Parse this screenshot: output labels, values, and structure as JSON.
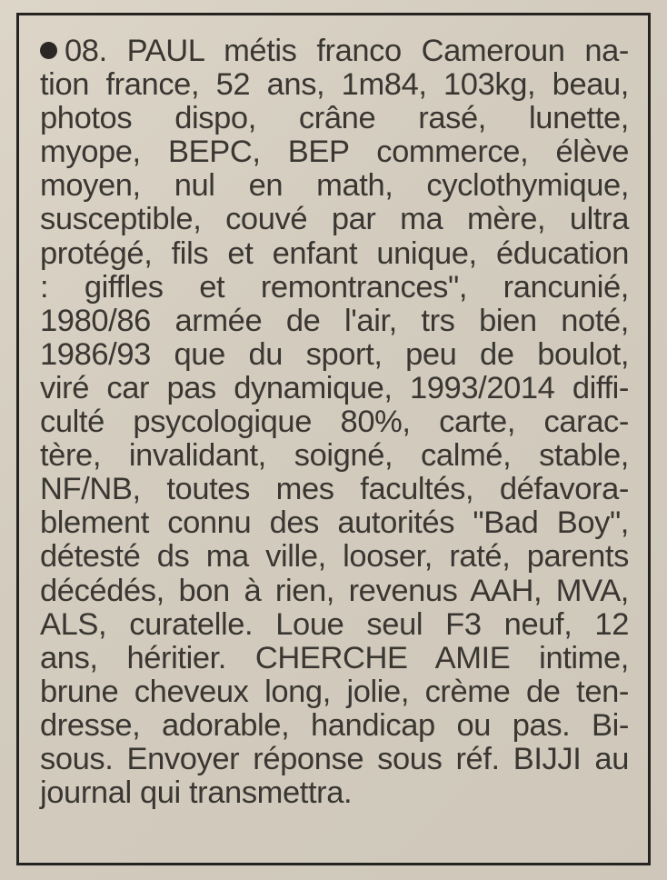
{
  "ad": {
    "lines": [
      "08. PAUL métis franco Cameroun na-",
      "tion france, 52 ans, 1m84, 103kg, beau,",
      "photos dispo, crâne rasé, lunette,",
      "myope, BEPC, BEP commerce, élève",
      "moyen, nul en math, cyclothymique,",
      "susceptible, couvé par ma mère, ultra",
      "protégé, fils et enfant unique, éducation",
      ": giffles et remontrances\", rancunié,",
      "1980/86 armée de l'air, trs bien noté,",
      "1986/93 que du sport, peu de boulot,",
      "viré car pas dynamique, 1993/2014 diffi-",
      "culté psycologique 80%, carte, carac-",
      "tère, invalidant, soigné, calmé, stable,",
      "NF/NB, toutes mes facultés, défavora-",
      "blement connu des autorités \"Bad Boy\",",
      "détesté ds ma ville, looser, raté, parents",
      "décédés, bon à rien, revenus AAH, MVA,",
      "ALS, curatelle. Loue seul F3 neuf, 12",
      "ans, héritier. CHERCHE AMIE intime,",
      "brune cheveux long, jolie, crème de ten-",
      "dresse, adorable, handicap ou pas. Bi-",
      "sous. Envoyer réponse sous réf. BIJJI au",
      "journal qui transmettra."
    ]
  }
}
